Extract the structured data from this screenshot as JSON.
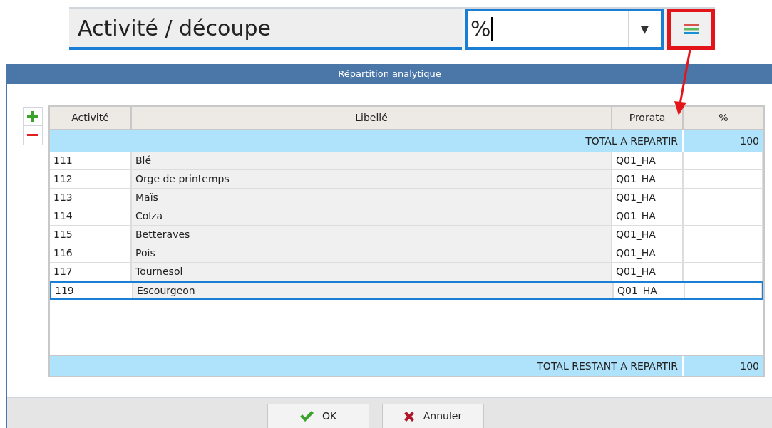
{
  "header": {
    "label": "Activité / découpe",
    "combo": {
      "value": "%",
      "caret": "▼"
    }
  },
  "dialog": {
    "title": "Répartition analytique",
    "table": {
      "columns": [
        "Activité",
        "Libellé",
        "Prorata",
        "%"
      ],
      "total": {
        "label": "TOTAL A REPARTIR",
        "value": "100"
      },
      "rows": [
        {
          "code": "111",
          "label": "Blé",
          "prorata": "Q01_HA",
          "selected": false
        },
        {
          "code": "112",
          "label": "Orge de printemps",
          "prorata": "Q01_HA",
          "selected": false
        },
        {
          "code": "113",
          "label": "Maïs",
          "prorata": "Q01_HA",
          "selected": false
        },
        {
          "code": "114",
          "label": "Colza",
          "prorata": "Q01_HA",
          "selected": false
        },
        {
          "code": "115",
          "label": "Betteraves",
          "prorata": "Q01_HA",
          "selected": false
        },
        {
          "code": "116",
          "label": "Pois",
          "prorata": "Q01_HA",
          "selected": false
        },
        {
          "code": "117",
          "label": "Tournesol",
          "prorata": "Q01_HA",
          "selected": false
        },
        {
          "code": "119",
          "label": "Escourgeon",
          "prorata": "Q01_HA",
          "selected": true
        }
      ],
      "remaining": {
        "label": "TOTAL RESTANT A REPARTIR",
        "value": "100"
      }
    },
    "buttons": [
      {
        "kind": "ok",
        "label": "OK"
      },
      {
        "kind": "cancel",
        "label": "Annuler"
      }
    ]
  }
}
